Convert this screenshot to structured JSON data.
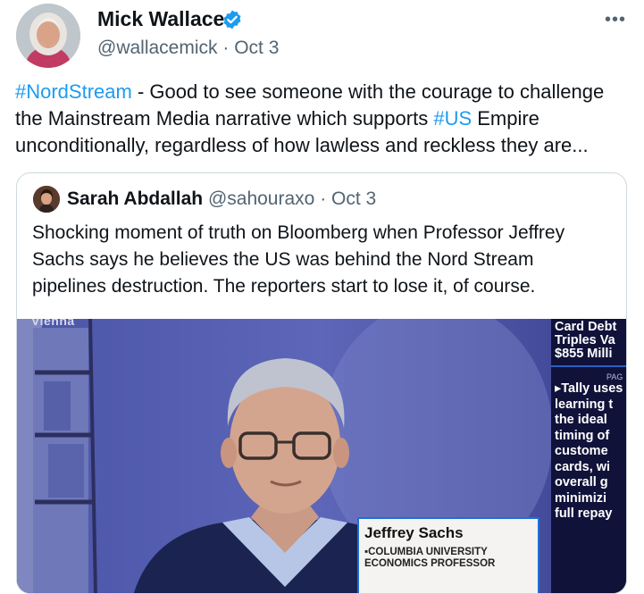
{
  "tweet": {
    "author_name": "Mick Wallace",
    "handle": "@wallacemick",
    "separator": "·",
    "date": "Oct 3",
    "text_parts": {
      "hashtag1": "#NordStream",
      "part1": " - Good to see someone with the courage to challenge the Mainstream Media narrative which supports ",
      "hashtag2": "#US",
      "part2": " Empire unconditionally, regardless of how lawless and reckless they are..."
    },
    "more_label": "•••"
  },
  "quote": {
    "author_name": "Sarah Abdallah",
    "handle": "@sahouraxo",
    "separator": "·",
    "date": "Oct 3",
    "text": "Shocking moment of truth on Bloomberg when Professor Jeffrey Sachs says he believes the US was behind the Nord Stream pipelines destruction. The reporters start to lose it, of course."
  },
  "media": {
    "location": "Vienna",
    "lower_third_name": "Jeffrey Sachs",
    "lower_third_title": "▪COLUMBIA UNIVERSITY ECONOMICS PROFESSOR",
    "ticker_headline": "Card Debt\nTriples Va\n$855 Milli",
    "ticker_page": "PAG",
    "ticker_body": "▸Tally uses\nlearning t\nthe ideal\ntiming of\ncustome\ncards, wi\noverall g\nminimizi\nfull repay"
  },
  "colors": {
    "link": "#1d9bf0",
    "verified": "#1d9bf0",
    "text": "#0f1419",
    "secondary": "#536471",
    "border": "#cfd9de"
  },
  "icons": {
    "verified": "verified-badge-icon",
    "more": "more-options-icon"
  }
}
